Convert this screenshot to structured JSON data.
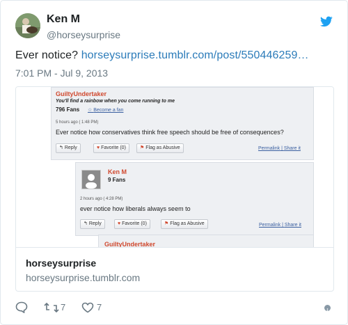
{
  "author": {
    "name": "Ken M",
    "handle": "@horseysurprise"
  },
  "tweet": {
    "text_prefix": "Ever notice? ",
    "link_text": "horseysurprise.tumblr.com/post/550446259…",
    "timestamp": "7:01 PM - Jul 9, 2013"
  },
  "card": {
    "title": "horseysurprise",
    "url": "horseysurprise.tumblr.com",
    "image": {
      "post1": {
        "username": "GuiltyUndertaker",
        "tagline": "You'll find a rainbow when you come running to me",
        "fans": "796 Fans",
        "become_fan": "Become a fan",
        "ago": "5 hours ago ( 1:48 PM)",
        "comment": "Ever notice how conservatives think free speech should be free of consequences?",
        "reply": "Reply",
        "favorite": "Favorite (0)",
        "flag": "Flag as Abusive",
        "permalink": "Permalink",
        "share": "Share it"
      },
      "post2": {
        "username": "Ken M",
        "fans": "9 Fans",
        "ago": "2 hours ago ( 4:28 PM)",
        "comment": "ever notice how liberals always seem to",
        "reply": "Reply",
        "favorite": "Favorite (0)",
        "flag": "Flag as Abusive",
        "permalink": "Permalink",
        "share": "Share it"
      },
      "post3": {
        "username": "GuiltyUndertaker"
      }
    }
  },
  "actions": {
    "retweets": "7",
    "likes": "7"
  },
  "colors": {
    "link": "#2b7bb9",
    "twitter_blue": "#1da1f2",
    "muted": "#697882"
  }
}
